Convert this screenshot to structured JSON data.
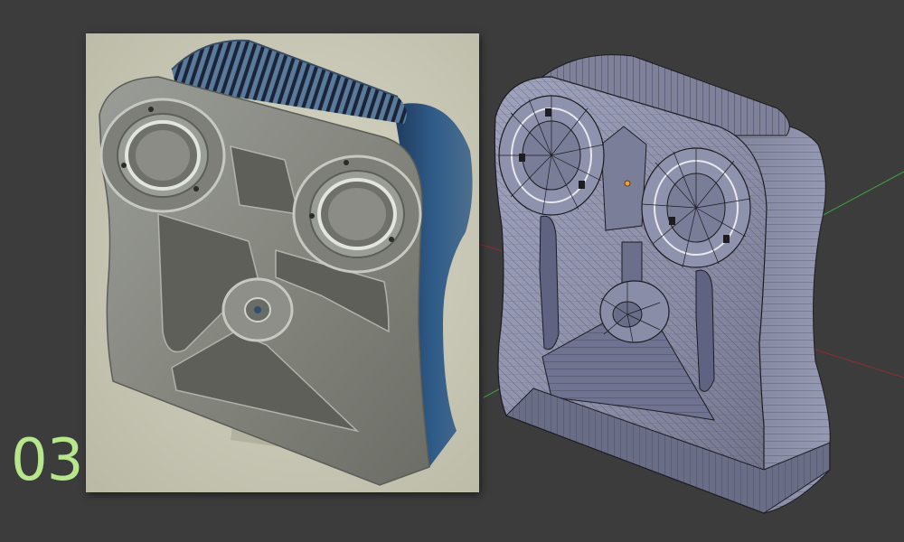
{
  "step": {
    "number": "03",
    "color": "#b7e68c"
  },
  "colors": {
    "background": "#3c3c3c",
    "render_backdrop": "#c9c8b6",
    "metal": "#8a8d88",
    "accent_blue": "#2c4f78",
    "wireframe_fill": "#8c8fa8",
    "wire": "#1c1c22",
    "axis_x": "#8a2e2e",
    "axis_y": "#3f9e3f"
  },
  "icons": {
    "origin": "origin-dot-icon",
    "lens": "lens-icon"
  }
}
